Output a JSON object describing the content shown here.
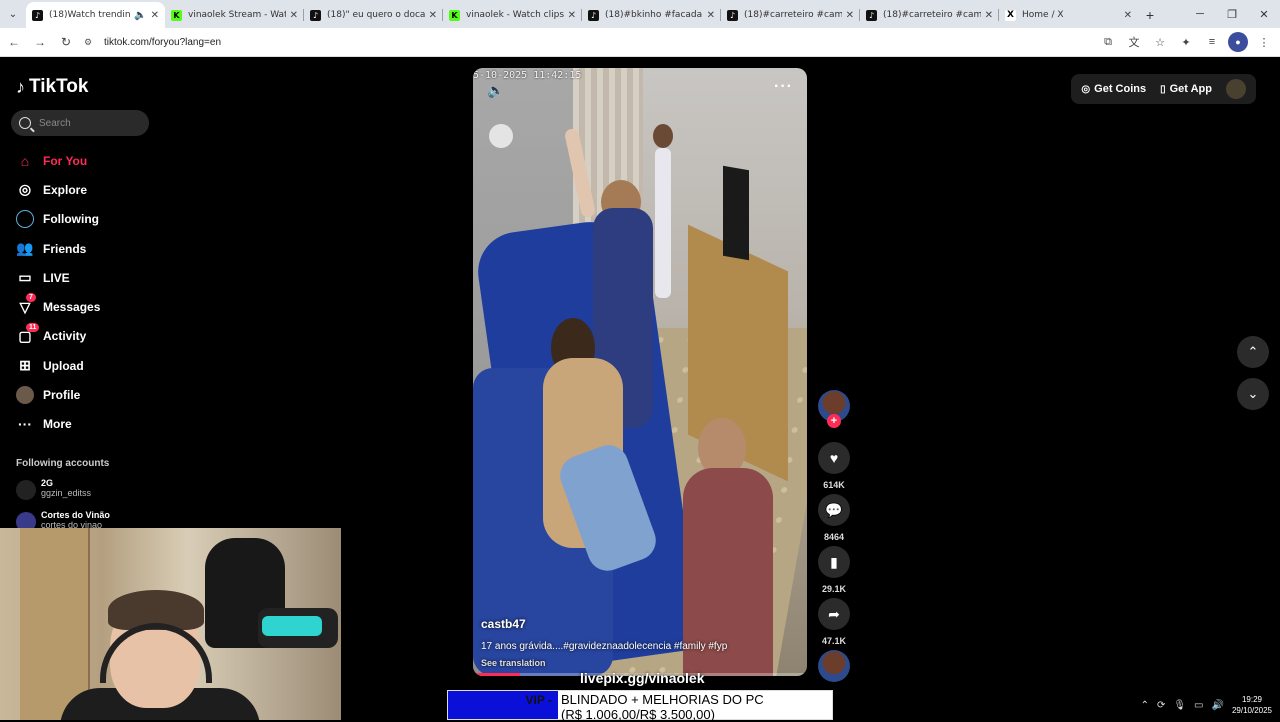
{
  "browser": {
    "tabs": [
      {
        "title": "(18)Watch trending vi",
        "icon": "tiktok-icon",
        "active": true
      },
      {
        "title": "vinaolek Stream - Watch",
        "icon": "kick-icon",
        "active": false
      },
      {
        "title": "(18)\" eu quero o doca",
        "icon": "tiktok-icon",
        "active": false
      },
      {
        "title": "vinaolek - Watch clips on",
        "icon": "kick-icon",
        "active": false
      },
      {
        "title": "(18)#bkinho #facada #an",
        "icon": "tiktok-icon",
        "active": false
      },
      {
        "title": "(18)#carreteiro #caminho",
        "icon": "tiktok-icon",
        "active": false
      },
      {
        "title": "(18)#carreteiro #caminho",
        "icon": "tiktok-icon",
        "active": false
      },
      {
        "title": "Home / X",
        "icon": "x-icon",
        "active": false
      }
    ],
    "url": "tiktok.com/foryou?lang=en"
  },
  "tiktok": {
    "logo": "TikTok",
    "search_placeholder": "Search",
    "nav": [
      {
        "label": "For You",
        "icon": "home-icon",
        "active": true
      },
      {
        "label": "Explore",
        "icon": "compass-icon"
      },
      {
        "label": "Following",
        "icon": "following-ring-icon"
      },
      {
        "label": "Friends",
        "icon": "friends-icon"
      },
      {
        "label": "LIVE",
        "icon": "live-icon"
      },
      {
        "label": "Messages",
        "icon": "messages-icon",
        "badge": "7"
      },
      {
        "label": "Activity",
        "icon": "activity-icon",
        "badge": "11"
      },
      {
        "label": "Upload",
        "icon": "upload-icon"
      },
      {
        "label": "Profile",
        "icon": "profile-avatar"
      },
      {
        "label": "More",
        "icon": "more-icon"
      }
    ],
    "following_title": "Following accounts",
    "following_accounts": [
      {
        "name": "2G",
        "handle": "ggzin_editss"
      },
      {
        "name": "Cortes do Vinão",
        "handle": "cortes do vinao"
      }
    ],
    "top_right": {
      "get_coins": "Get Coins",
      "get_app": "Get App"
    },
    "video": {
      "timestamp": "5-10-2025 11:42:15",
      "author": "castb47",
      "description": "17 anos grávida....#gravideznaadolecencia #family #fyp",
      "see_translation": "See translation",
      "progress": 0.14
    },
    "actions": {
      "likes": "614K",
      "comments": "8464",
      "saves": "29.1K",
      "shares": "47.1K"
    }
  },
  "stream_overlay": {
    "livepix": "livepix.gg/vinaolek",
    "banner_left": "VIP -",
    "banner_line1": "BLINDADO + MELHORIAS DO PC",
    "banner_line2": "(R$ 1.006,00/R$ 3.500,00)"
  },
  "taskbar": {
    "time": "19:29",
    "date": "29/10/2025"
  }
}
